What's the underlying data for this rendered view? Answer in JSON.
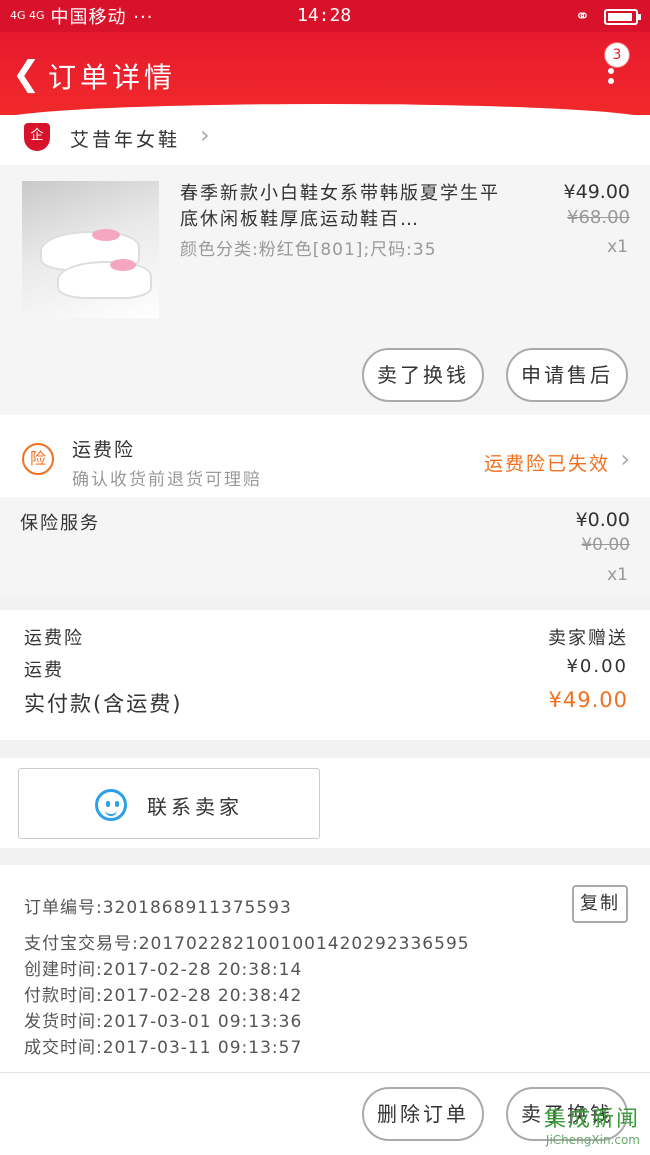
{
  "status_bar": {
    "network": "4G 4G",
    "carrier": "中国移动 ···",
    "time": "14:28"
  },
  "header": {
    "title": "订单详情",
    "badge_count": "3"
  },
  "shop": {
    "logo_text": "企",
    "name": "艾昔年女鞋"
  },
  "product": {
    "title": "春季新款小白鞋女系带韩版夏学生平底休闲板鞋厚底运动鞋百…",
    "spec": "颜色分类:粉红色[801];尺码:35",
    "price": "¥49.00",
    "original_price": "¥68.00",
    "quantity": "x1",
    "resell_button": "卖了换钱",
    "aftersale_button": "申请售后"
  },
  "shipping_insurance": {
    "icon_text": "险",
    "title": "运费险",
    "subtitle": "确认收货前退货可理赔",
    "status": "运费险已失效"
  },
  "insurance_service": {
    "label": "保险服务",
    "price": "¥0.00",
    "original_price": "¥0.00",
    "quantity": "x1"
  },
  "summary": {
    "shipping_insurance_label": "运费险",
    "shipping_insurance_value": "卖家赠送",
    "shipping_label": "运费",
    "shipping_value": "¥0.00",
    "total_label": "实付款(含运费)",
    "total_value": "¥49.00"
  },
  "contact": {
    "label": "联系卖家"
  },
  "order_info": {
    "order_no": "订单编号:3201868911375593",
    "alipay_no": "支付宝交易号:2017022821001001420292336595",
    "created": "创建时间:2017-02-28 20:38:14",
    "paid": "付款时间:2017-02-28 20:38:42",
    "shipped": "发货时间:2017-03-01 09:13:36",
    "completed": "成交时间:2017-03-11 09:13:57",
    "copy_button": "复制"
  },
  "bottom_bar": {
    "delete_button": "删除订单",
    "resell_button": "卖了换钱"
  },
  "watermark": {
    "brand": "集成新闻",
    "url": "JiChengXin.com"
  },
  "colors": {
    "brand_red": "#e51a2e",
    "accent_orange": "#f07020",
    "contact_blue": "#2aa0e8"
  }
}
